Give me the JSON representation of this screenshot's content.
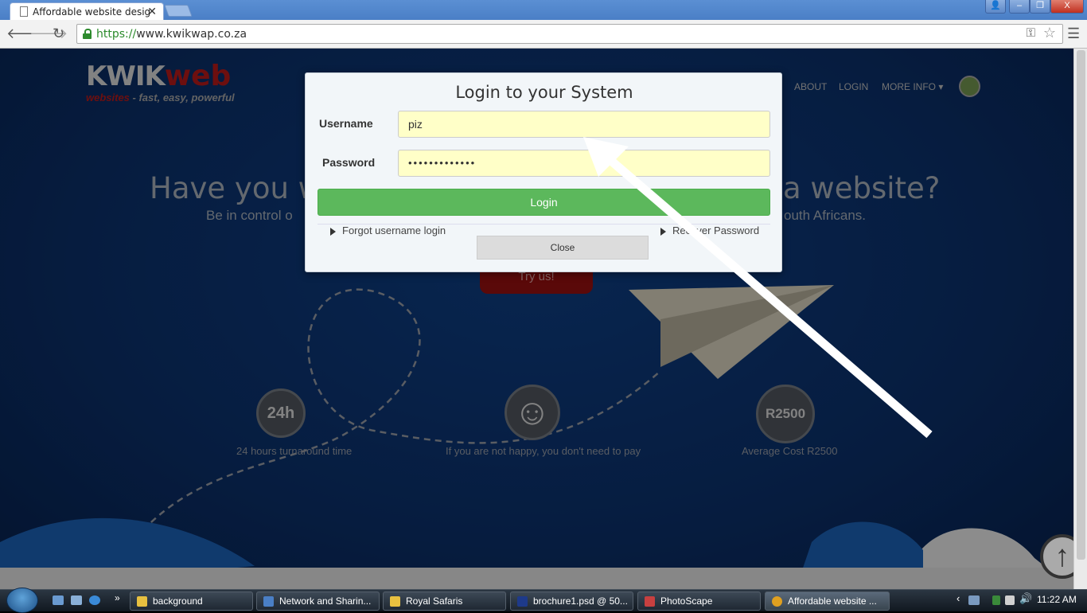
{
  "browser": {
    "tab_title": "Affordable website design",
    "tab_close": "✕",
    "window_buttons": {
      "user": "👤",
      "minimize": "–",
      "restore": "❐",
      "close": "X"
    },
    "url_scheme": "https://",
    "url_host": "www.kwikwap.co.za"
  },
  "site": {
    "logo_kwik": "KWIK",
    "logo_web": "web",
    "tagline_w": "websites",
    "tagline_rest": " - fast, easy, powerful",
    "nav": [
      "ABOUT",
      "LOGIN",
      "MORE INFO"
    ],
    "hero_left": "Have you w",
    "hero_right": "a website?",
    "sub_left": "Be in control o",
    "sub_right": "outh Africans.",
    "try_label": "Try us!",
    "features": [
      {
        "icon_text": "24h",
        "label": "24 hours turnaround time"
      },
      {
        "icon_text": "☺",
        "label": "If you are not happy, you don't need to pay"
      },
      {
        "icon_text": "R2500",
        "label": "Average Cost R2500"
      }
    ]
  },
  "modal": {
    "title": "Login to your System",
    "username_label": "Username",
    "username_value": "piz",
    "password_label": "Password",
    "password_value": "•••••••••••••",
    "login_label": "Login",
    "forgot_link": "Forgot username login",
    "recover_link": "Recover Password",
    "close_label": "Close"
  },
  "taskbar": {
    "buttons": [
      {
        "label": "background",
        "color": "#e8c040"
      },
      {
        "label": "Network and Sharin...",
        "color": "#4a7fc6"
      },
      {
        "label": "Royal Safaris",
        "color": "#e8c040"
      },
      {
        "label": "brochure1.psd @ 50...",
        "color": "#1e3a8a"
      },
      {
        "label": "PhotoScape",
        "color": "#c84040"
      },
      {
        "label": "Affordable website ...",
        "color": "#e0a020"
      }
    ],
    "clock": "11:22 AM"
  },
  "colors": {
    "login_green": "#5cb85c",
    "input_yellow": "#ffffc8",
    "brand_red": "#a81818"
  }
}
